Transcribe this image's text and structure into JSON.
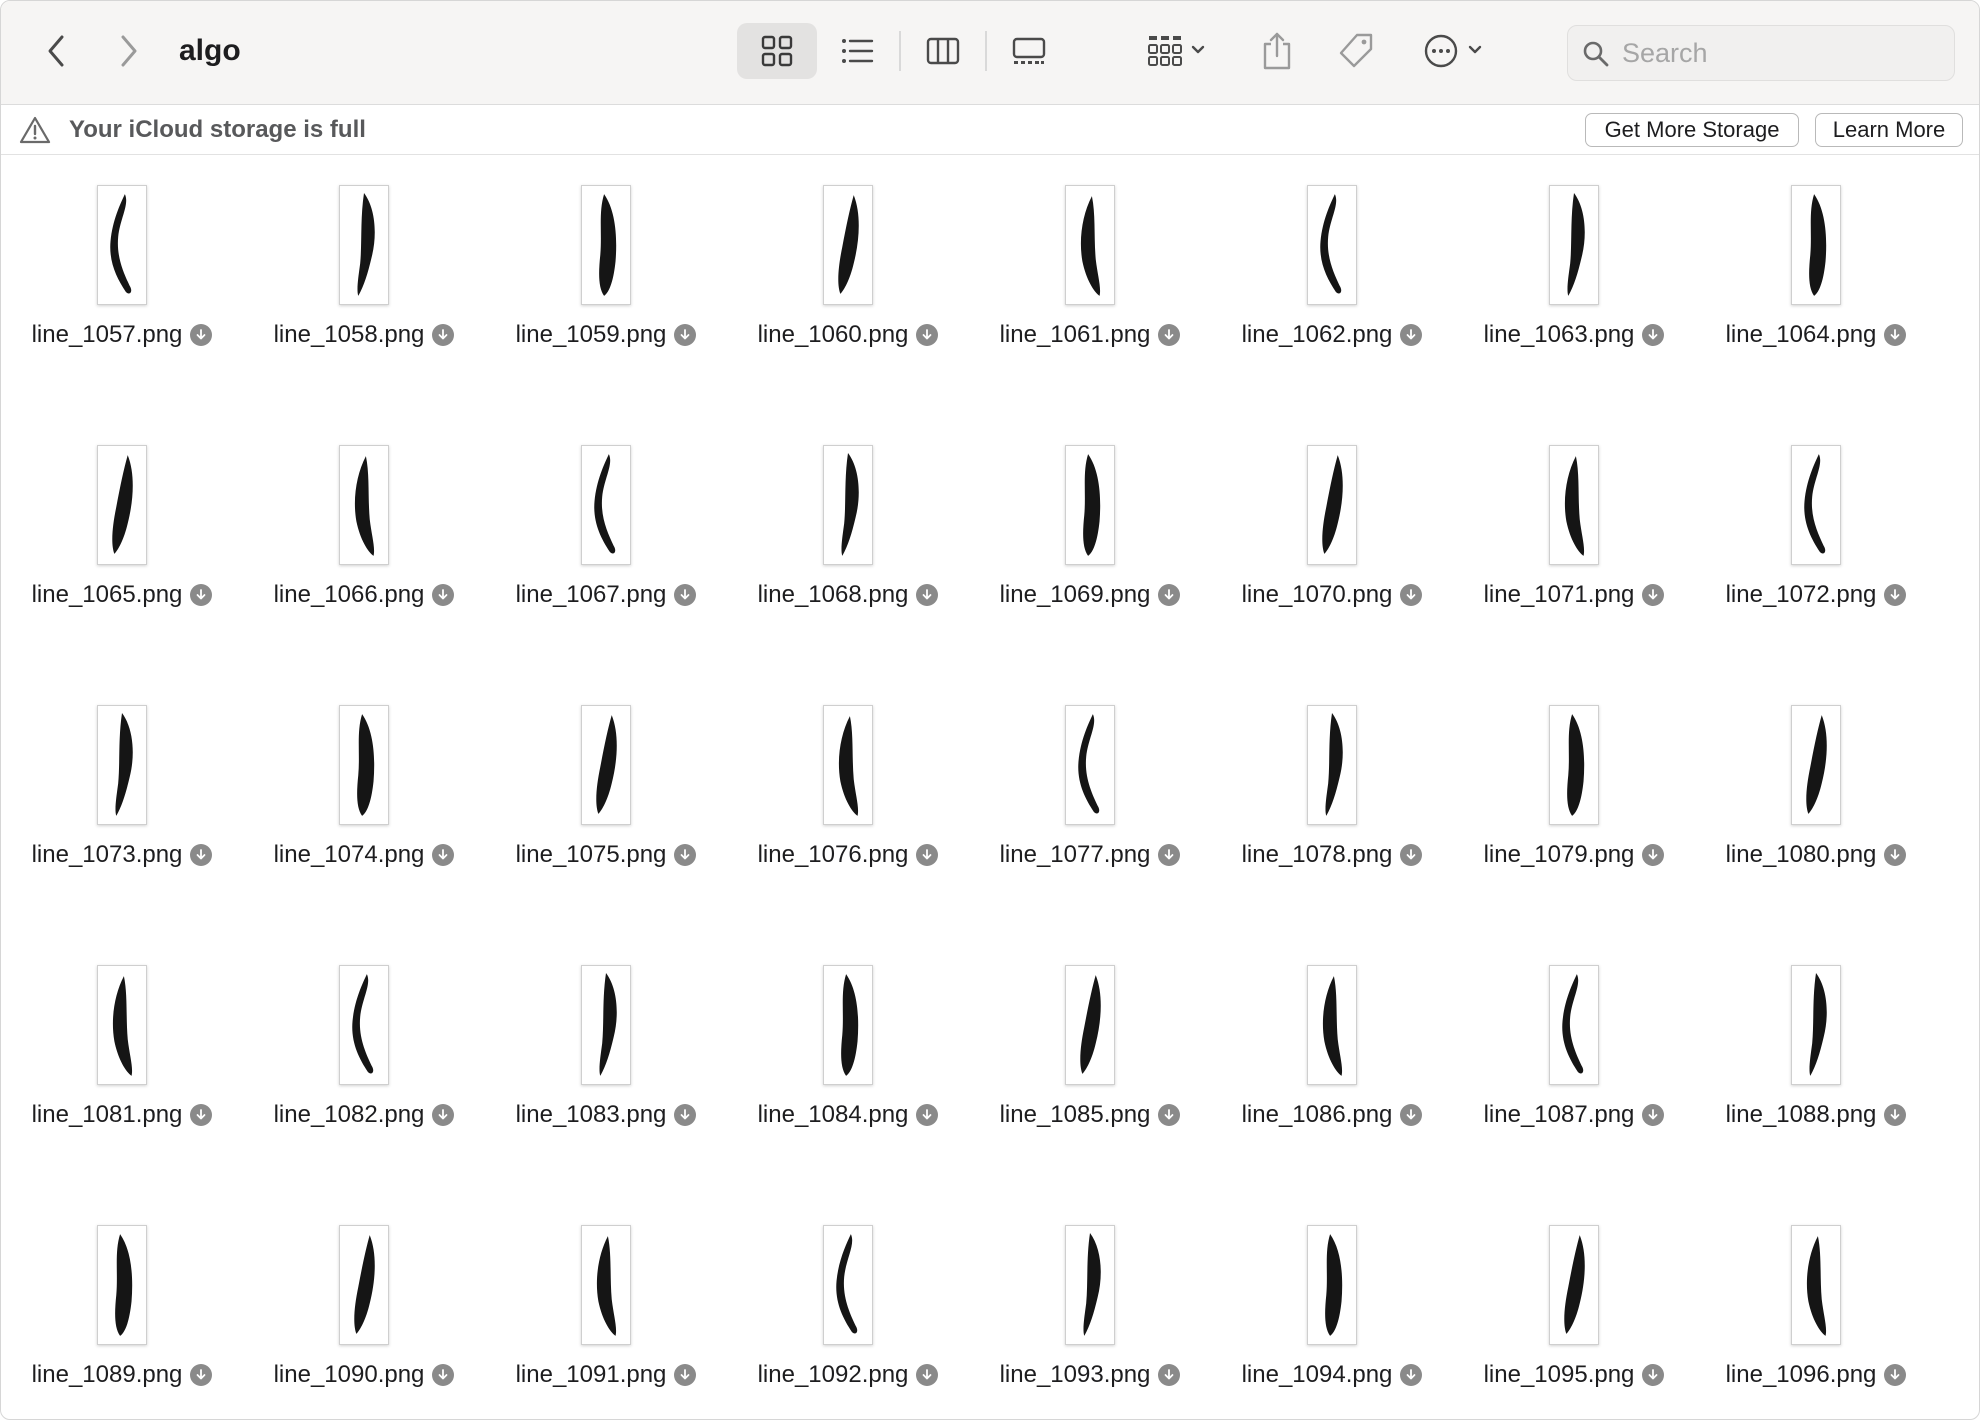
{
  "window": {
    "title": "algo"
  },
  "toolbar": {
    "back_icon": "chevron-left-icon",
    "forward_icon": "chevron-right-icon",
    "views": [
      "icon-view-icon",
      "list-view-icon",
      "column-view-icon",
      "gallery-view-icon"
    ],
    "active_view": "icon-view-icon",
    "group_icon": "group-grid-icon",
    "share_icon": "share-icon",
    "tag_icon": "tag-icon",
    "more_icon": "ellipsis-circle-icon",
    "search_placeholder": "Search"
  },
  "notice": {
    "icon": "warning-triangle-icon",
    "message": "Your iCloud storage is full",
    "get_storage_label": "Get More Storage",
    "learn_more_label": "Learn More"
  },
  "files": [
    {
      "name": "line_1057.png"
    },
    {
      "name": "line_1058.png"
    },
    {
      "name": "line_1059.png"
    },
    {
      "name": "line_1060.png"
    },
    {
      "name": "line_1061.png"
    },
    {
      "name": "line_1062.png"
    },
    {
      "name": "line_1063.png"
    },
    {
      "name": "line_1064.png"
    },
    {
      "name": "line_1065.png"
    },
    {
      "name": "line_1066.png"
    },
    {
      "name": "line_1067.png"
    },
    {
      "name": "line_1068.png"
    },
    {
      "name": "line_1069.png"
    },
    {
      "name": "line_1070.png"
    },
    {
      "name": "line_1071.png"
    },
    {
      "name": "line_1072.png"
    },
    {
      "name": "line_1073.png"
    },
    {
      "name": "line_1074.png"
    },
    {
      "name": "line_1075.png"
    },
    {
      "name": "line_1076.png"
    },
    {
      "name": "line_1077.png"
    },
    {
      "name": "line_1078.png"
    },
    {
      "name": "line_1079.png"
    },
    {
      "name": "line_1080.png"
    },
    {
      "name": "line_1081.png"
    },
    {
      "name": "line_1082.png"
    },
    {
      "name": "line_1083.png"
    },
    {
      "name": "line_1084.png"
    },
    {
      "name": "line_1085.png"
    },
    {
      "name": "line_1086.png"
    },
    {
      "name": "line_1087.png"
    },
    {
      "name": "line_1088.png"
    },
    {
      "name": "line_1089.png"
    },
    {
      "name": "line_1090.png"
    },
    {
      "name": "line_1091.png"
    },
    {
      "name": "line_1092.png"
    },
    {
      "name": "line_1093.png"
    },
    {
      "name": "line_1094.png"
    },
    {
      "name": "line_1095.png"
    },
    {
      "name": "line_1096.png"
    }
  ],
  "file_status_icon": "cloud-download-icon",
  "thumbnail_icon": "image-thumbnail-icon"
}
